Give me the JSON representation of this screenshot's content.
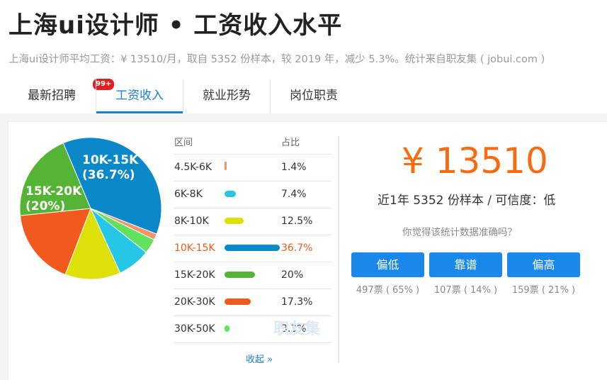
{
  "title": "上海ui设计师 • 工资收入水平",
  "summary": "上海ui设计师平均工资：¥ 13510/月，取自 5352 份样本，较 2019 年，减少 5.3%。统计来自职友集 ( jobui.com )",
  "tabs": [
    {
      "label": "最新招聘",
      "badge": "99+"
    },
    {
      "label": "工资收入",
      "active": true
    },
    {
      "label": "就业形势"
    },
    {
      "label": "岗位职责"
    }
  ],
  "table": {
    "header_range": "区间",
    "header_pct": "占比",
    "rows": [
      {
        "range": "4.5K-6K",
        "pct_label": "1.4%",
        "value": 1.4,
        "color": "#f4936b"
      },
      {
        "range": "6K-8K",
        "pct_label": "7.4%",
        "value": 7.4,
        "color": "#25c6e6"
      },
      {
        "range": "8K-10K",
        "pct_label": "12.5%",
        "value": 12.5,
        "color": "#dde009"
      },
      {
        "range": "10K-15K",
        "pct_label": "36.7%",
        "value": 36.7,
        "color": "#0a88c8"
      },
      {
        "range": "15K-20K",
        "pct_label": "20%",
        "value": 20,
        "color": "#55b335"
      },
      {
        "range": "20K-30K",
        "pct_label": "17.3%",
        "value": 17.3,
        "color": "#f05a1f"
      },
      {
        "range": "30K-50K",
        "pct_label": "3.3%",
        "value": 3.3,
        "color": "#63e15c"
      }
    ],
    "collapse_label": "收起 »",
    "watermark": "职友集"
  },
  "pie_labels": {
    "a_range": "10K-15K",
    "a_pct": "(36.7%)",
    "b_range": "15K-20K",
    "b_pct": "(20%)"
  },
  "salary": {
    "amount": "¥ 13510",
    "sample_line": "近1年 5352 份样本 / 可信度：低",
    "question": "你觉得该统计数据准确吗？"
  },
  "votes": [
    {
      "label": "偏低",
      "count": "497票 ( 65% )"
    },
    {
      "label": "靠谱",
      "count": "107票 ( 14% )"
    },
    {
      "label": "偏高",
      "count": "159票 ( 21% )"
    }
  ],
  "colors": {
    "accent": "#1a7fd6",
    "salary": "#f56c12",
    "button": "#1a88ea",
    "highlight": "#f25a1c"
  }
}
